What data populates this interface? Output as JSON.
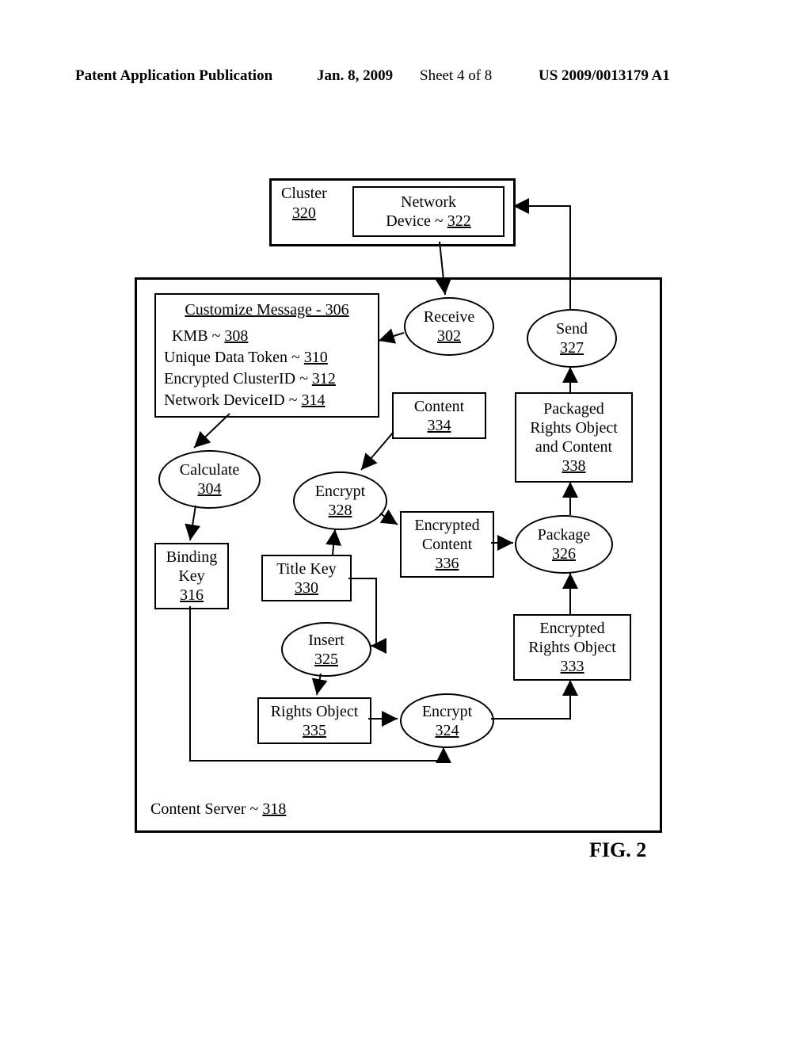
{
  "header": {
    "left": "Patent Application Publication",
    "date": "Jan. 8, 2009",
    "sheet": "Sheet 4 of 8",
    "pubno": "US 2009/0013179 A1"
  },
  "figure_label": "FIG. 2",
  "cluster": {
    "label": "Cluster",
    "ref": "320"
  },
  "network_device": {
    "label": "Network",
    "label2": "Device ~",
    "ref": "322"
  },
  "content_server": {
    "label": "Content Server ~",
    "ref": "318"
  },
  "customize_msg": {
    "title": "Customize Message -",
    "title_ref": "306",
    "line1a": "KMB ~",
    "line1_ref": "308",
    "line2a": "Unique Data Token ~",
    "line2_ref": "310",
    "line3a": "Encrypted ClusterID ~",
    "line3_ref": "312",
    "line4a": "Network DeviceID ~",
    "line4_ref": "314"
  },
  "receive": {
    "label": "Receive",
    "ref": "302"
  },
  "send": {
    "label": "Send",
    "ref": "327"
  },
  "calculate": {
    "label": "Calculate",
    "ref": "304"
  },
  "encrypt1": {
    "label": "Encrypt",
    "ref": "328"
  },
  "content": {
    "label": "Content",
    "ref": "334"
  },
  "packaged": {
    "l1": "Packaged",
    "l2": "Rights Object",
    "l3": "and Content",
    "ref": "338"
  },
  "encrypted_content": {
    "l1": "Encrypted",
    "l2": "Content",
    "ref": "336"
  },
  "package": {
    "label": "Package",
    "ref": "326"
  },
  "binding_key": {
    "l1": "Binding",
    "l2": "Key",
    "ref": "316"
  },
  "title_key": {
    "l1": "Title Key",
    "ref": "330"
  },
  "insert": {
    "label": "Insert",
    "ref": "325"
  },
  "encrypted_ro": {
    "l1": "Encrypted",
    "l2": "Rights Object",
    "ref": "333"
  },
  "rights_object": {
    "l1": "Rights Object",
    "ref": "335"
  },
  "encrypt2": {
    "label": "Encrypt",
    "ref": "324"
  }
}
